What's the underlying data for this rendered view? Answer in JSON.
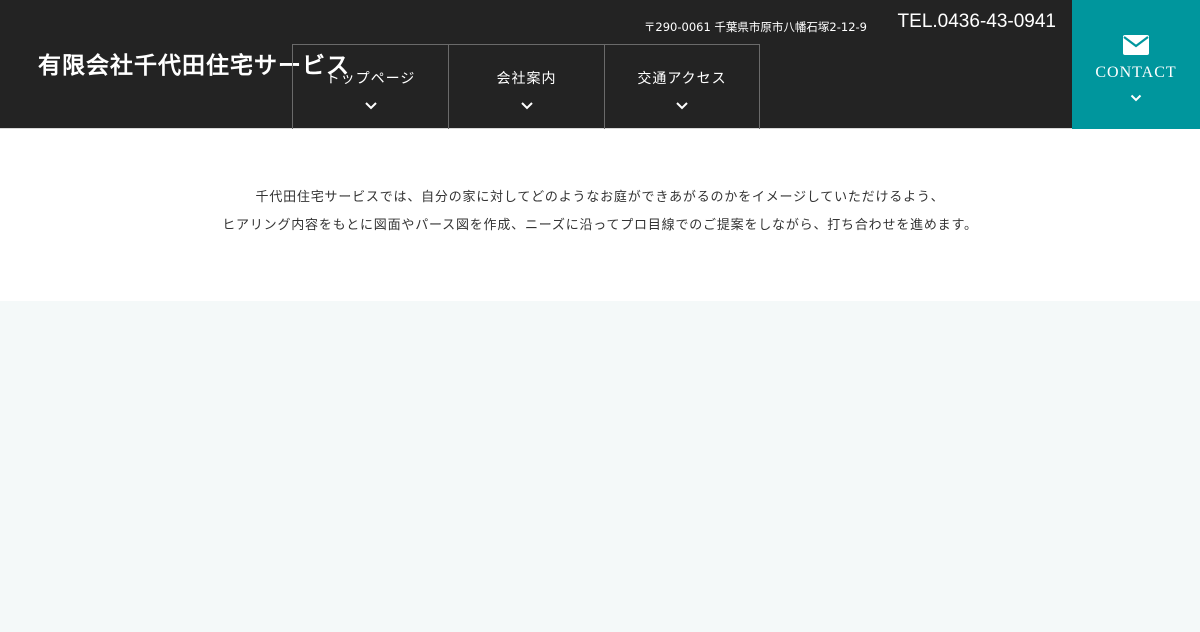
{
  "header": {
    "logo": "有限会社千代田住宅サービス",
    "address": "〒290-0061 千葉県市原市八幡石塚2-12-9",
    "tel": "TEL.0436-43-0941"
  },
  "nav": {
    "items": [
      {
        "label": "トップページ",
        "icon": "chevron-down-icon"
      },
      {
        "label": "会社案内",
        "icon": "chevron-down-icon"
      },
      {
        "label": "交通アクセス",
        "icon": "chevron-down-icon"
      }
    ]
  },
  "contact": {
    "label": "CONTACT",
    "icon": "mail-icon",
    "chevron": "chevron-down-icon",
    "bg_color": "#00969d"
  },
  "intro": {
    "line1": "千代田住宅サービスでは、自分の家に対してどのようなお庭ができあがるのかをイメージしていただけるよう、",
    "line2": "ヒアリング内容をもとに図面やパース図を作成、ニーズに沿ってプロ目線でのご提案をしながら、打ち合わせを進めます。"
  },
  "colors": {
    "header_bg": "#232323",
    "accent": "#00969d",
    "section_bg": "#f4f9f9"
  }
}
